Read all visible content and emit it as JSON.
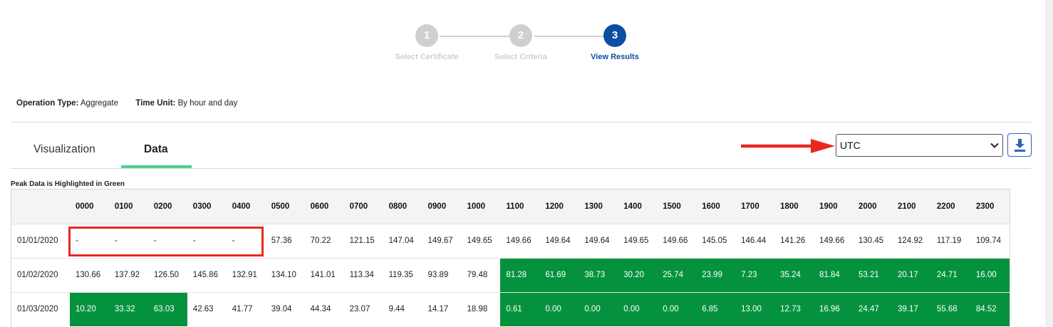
{
  "stepper": {
    "steps": [
      {
        "number": "1",
        "label": "Select Certificate",
        "state": "done"
      },
      {
        "number": "2",
        "label": "Select Criteria",
        "state": "done"
      },
      {
        "number": "3",
        "label": "View Results",
        "state": "active"
      }
    ]
  },
  "meta": {
    "operation_type_label": "Operation Type:",
    "operation_type_value": "Aggregate",
    "time_unit_label": "Time Unit:",
    "time_unit_value": "By hour and day"
  },
  "tabs": [
    {
      "label": "Visualization",
      "active": false
    },
    {
      "label": "Data",
      "active": true
    }
  ],
  "timezone_select": {
    "value": "UTC"
  },
  "download_button": {
    "icon": "download-icon"
  },
  "peak_note": "Peak Data is Highlighted in Green",
  "colors": {
    "peak": "#05923e",
    "active_step": "#0b4ea2",
    "tab_underline": "#4fcf8e",
    "annotation": "#e8281e"
  },
  "table": {
    "hours": [
      "0000",
      "0100",
      "0200",
      "0300",
      "0400",
      "0500",
      "0600",
      "0700",
      "0800",
      "0900",
      "1000",
      "1100",
      "1200",
      "1300",
      "1400",
      "1500",
      "1600",
      "1700",
      "1800",
      "1900",
      "2000",
      "2100",
      "2200",
      "2300"
    ],
    "rows": [
      {
        "date": "01/01/2020",
        "values": [
          "-",
          "-",
          "-",
          "-",
          "-",
          "57.36",
          "70.22",
          "121.15",
          "147.04",
          "149.67",
          "149.65",
          "149.66",
          "149.64",
          "149.64",
          "149.65",
          "149.66",
          "145.05",
          "146.44",
          "141.26",
          "149.66",
          "130.45",
          "124.92",
          "117.19",
          "109.74"
        ],
        "peak": []
      },
      {
        "date": "01/02/2020",
        "values": [
          "130.66",
          "137.92",
          "126.50",
          "145.86",
          "132.91",
          "134.10",
          "141.01",
          "113.34",
          "119.35",
          "93.89",
          "79.48",
          "81.28",
          "61.69",
          "38.73",
          "30.20",
          "25.74",
          "23.99",
          "7.23",
          "35.24",
          "81.84",
          "53.21",
          "20.17",
          "24.71",
          "16.00"
        ],
        "peak": [
          11,
          12,
          13,
          14,
          15,
          16,
          17,
          18,
          19,
          20,
          21,
          22,
          23
        ]
      },
      {
        "date": "01/03/2020",
        "values": [
          "10.20",
          "33.32",
          "63.03",
          "42.63",
          "41.77",
          "39.04",
          "44.34",
          "23.07",
          "9.44",
          "14.17",
          "18.98",
          "0.61",
          "0.00",
          "0.00",
          "0.00",
          "0.00",
          "6.85",
          "13.00",
          "12.73",
          "16.96",
          "24.47",
          "39.17",
          "55.68",
          "84.52"
        ],
        "peak": [
          0,
          1,
          2,
          11,
          12,
          13,
          14,
          15,
          16,
          17,
          18,
          19,
          20,
          21,
          22,
          23
        ]
      }
    ]
  }
}
